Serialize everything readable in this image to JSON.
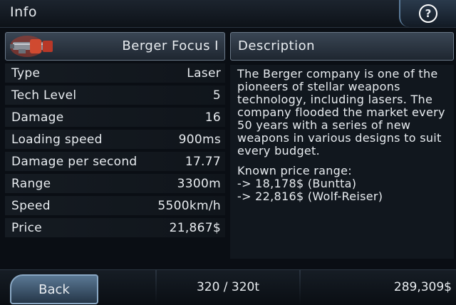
{
  "header": {
    "title": "Info",
    "help_label": "?"
  },
  "weapon": {
    "name": "Berger Focus I",
    "icon": "laser-gun-icon"
  },
  "stats": [
    {
      "label": "Type",
      "value": "Laser"
    },
    {
      "label": "Tech Level",
      "value": "5"
    },
    {
      "label": "Damage",
      "value": "16"
    },
    {
      "label": "Loading speed",
      "value": "900ms"
    },
    {
      "label": "Damage per second",
      "value": "17.77"
    },
    {
      "label": "Range",
      "value": "3300m"
    },
    {
      "label": "Speed",
      "value": "5500km/h"
    },
    {
      "label": "Price",
      "value": "21,867$"
    }
  ],
  "description": {
    "title": "Description",
    "text": "The Berger company is one of the pioneers of stellar weapons technology, including lasers. The company flooded the market every 50 years with a series of new weapons in various designs to suit every budget.",
    "price_range_title": "Known price range:",
    "price_lines": [
      "-> 18,178$ (Buntta)",
      "-> 22,816$ (Wolf-Reiser)"
    ]
  },
  "footer": {
    "back_label": "Back",
    "cargo": "320 / 320t",
    "money": "289,309$"
  }
}
